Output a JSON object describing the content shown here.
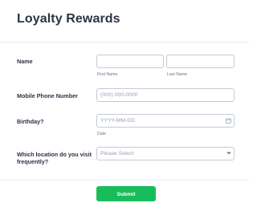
{
  "form": {
    "title": "Loyalty Rewards",
    "fields": {
      "name": {
        "label": "Name",
        "first_sublabel": "First Name",
        "last_sublabel": "Last Name",
        "first_value": "",
        "last_value": ""
      },
      "phone": {
        "label": "Mobile Phone Number",
        "placeholder": "(000) 000-0000"
      },
      "birthday": {
        "label": "Birthday?",
        "placeholder": "YYYY-MM-DD",
        "sublabel": "Date",
        "icon": "calendar-icon"
      },
      "location": {
        "label_line1": "Which location do you visit",
        "label_line2": "frequently?",
        "selected": "Please Select",
        "icon": "chevron-down-icon"
      }
    },
    "submit_label": "Submit"
  },
  "colors": {
    "accent": "#18bd5b",
    "text": "#2c3345",
    "border": "#c3cad8"
  }
}
